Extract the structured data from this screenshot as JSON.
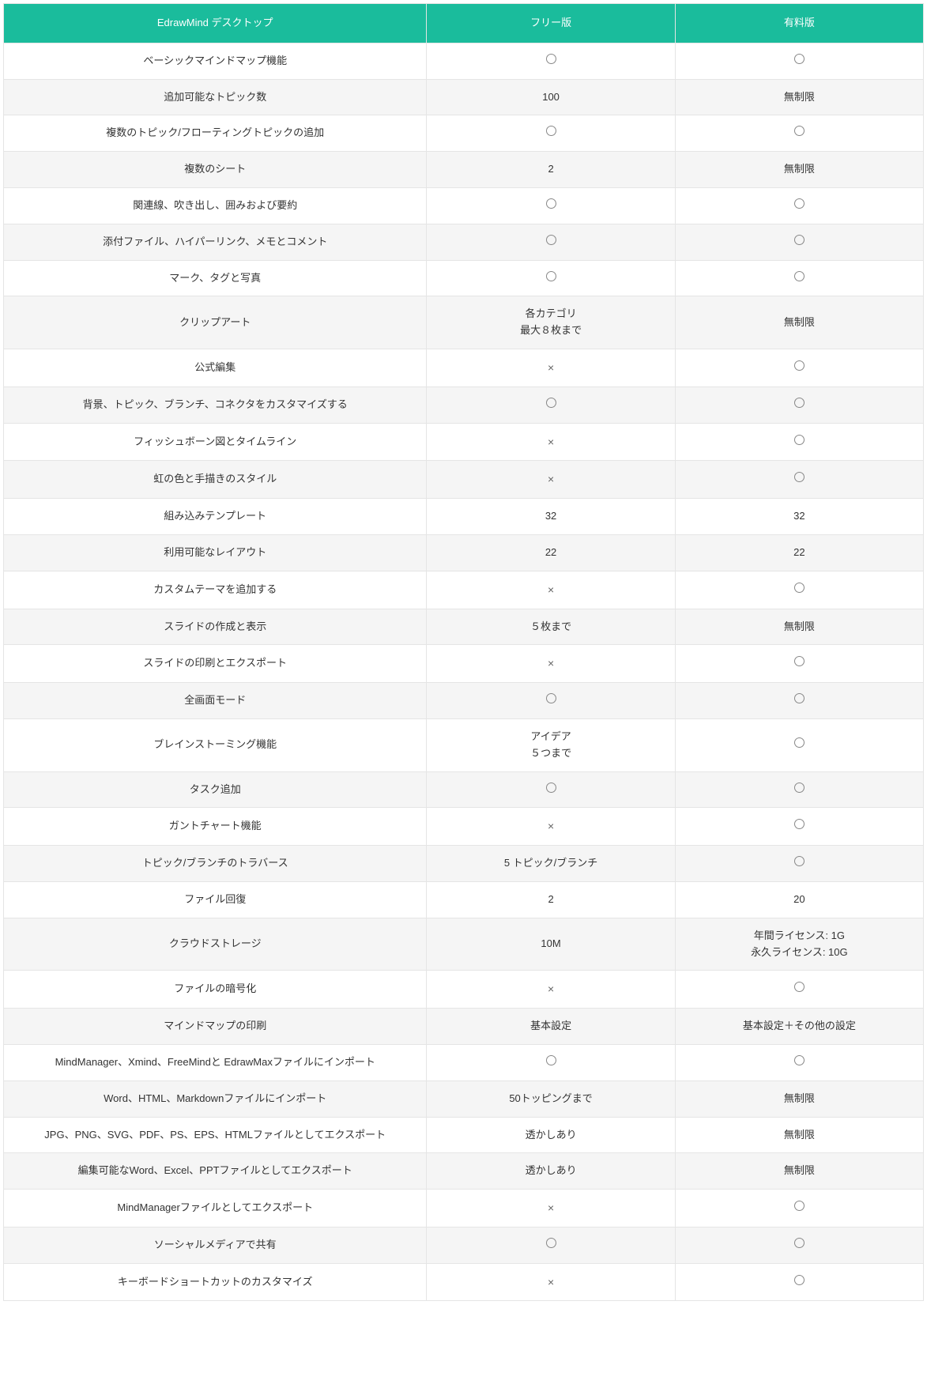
{
  "symbols": {
    "yes": "○",
    "no": "×"
  },
  "headers": {
    "feature": "EdrawMind デスクトップ",
    "free": "フリー版",
    "paid": "有料版"
  },
  "rows": [
    {
      "feature": "ベーシックマインドマップ機能",
      "free": "yes",
      "paid": "yes"
    },
    {
      "feature": "追加可能なトピック数",
      "free": "100",
      "paid": "無制限"
    },
    {
      "feature": "複数のトピック/フローティングトピックの追加",
      "free": "yes",
      "paid": "yes"
    },
    {
      "feature": "複数のシート",
      "free": "2",
      "paid": "無制限"
    },
    {
      "feature": "関連線、吹き出し、囲みおよび要約",
      "free": "yes",
      "paid": "yes"
    },
    {
      "feature": "添付ファイル、ハイパーリンク、メモとコメント",
      "free": "yes",
      "paid": "yes"
    },
    {
      "feature": "マーク、タグと写真",
      "free": "yes",
      "paid": "yes"
    },
    {
      "feature": "クリップアート",
      "free": "各カテゴリ\n最大８枚まで",
      "paid": "無制限"
    },
    {
      "feature": "公式編集",
      "free": "no",
      "paid": "yes"
    },
    {
      "feature": "背景、トピック、ブランチ、コネクタをカスタマイズする",
      "free": "yes",
      "paid": "yes"
    },
    {
      "feature": "フィッシュボーン図とタイムライン",
      "free": "no",
      "paid": "yes"
    },
    {
      "feature": "虹の色と手描きのスタイル",
      "free": "no",
      "paid": "yes"
    },
    {
      "feature": "組み込みテンプレート",
      "free": "32",
      "paid": "32"
    },
    {
      "feature": "利用可能なレイアウト",
      "free": "22",
      "paid": "22"
    },
    {
      "feature": "カスタムテーマを追加する",
      "free": "no",
      "paid": "yes"
    },
    {
      "feature": "スライドの作成と表示",
      "free": "５枚まで",
      "paid": "無制限"
    },
    {
      "feature": "スライドの印刷とエクスポート",
      "free": "no",
      "paid": "yes"
    },
    {
      "feature": "全画面モード",
      "free": "yes",
      "paid": "yes"
    },
    {
      "feature": "ブレインストーミング機能",
      "free": "アイデア\n５つまで",
      "paid": "yes"
    },
    {
      "feature": "タスク追加",
      "free": "yes",
      "paid": "yes"
    },
    {
      "feature": "ガントチャート機能",
      "free": "no",
      "paid": "yes"
    },
    {
      "feature": "トピック/ブランチのトラバース",
      "free": "5 トピック/ブランチ",
      "paid": "yes"
    },
    {
      "feature": "ファイル回復",
      "free": "2",
      "paid": "20"
    },
    {
      "feature": "クラウドストレージ",
      "free": "10M",
      "paid": "年間ライセンス: 1G\n永久ライセンス: 10G"
    },
    {
      "feature": "ファイルの暗号化",
      "free": "no",
      "paid": "yes"
    },
    {
      "feature": "マインドマップの印刷",
      "free": "基本設定",
      "paid": "基本設定＋その他の設定"
    },
    {
      "feature": "MindManager、Xmind、FreeMindと EdrawMaxファイルにインポート",
      "free": "yes",
      "paid": "yes"
    },
    {
      "feature": "Word、HTML、Markdownファイルにインポート",
      "free": "50トッピングまで",
      "paid": "無制限"
    },
    {
      "feature": "JPG、PNG、SVG、PDF、PS、EPS、HTMLファイルとしてエクスポート",
      "free": "透かしあり",
      "paid": "無制限"
    },
    {
      "feature": "編集可能なWord、Excel、PPTファイルとしてエクスポート",
      "free": "透かしあり",
      "paid": "無制限"
    },
    {
      "feature": "MindManagerファイルとしてエクスポート",
      "free": "no",
      "paid": "yes"
    },
    {
      "feature": "ソーシャルメディアで共有",
      "free": "yes",
      "paid": "yes"
    },
    {
      "feature": "キーボードショートカットのカスタマイズ",
      "free": "no",
      "paid": "yes"
    }
  ]
}
